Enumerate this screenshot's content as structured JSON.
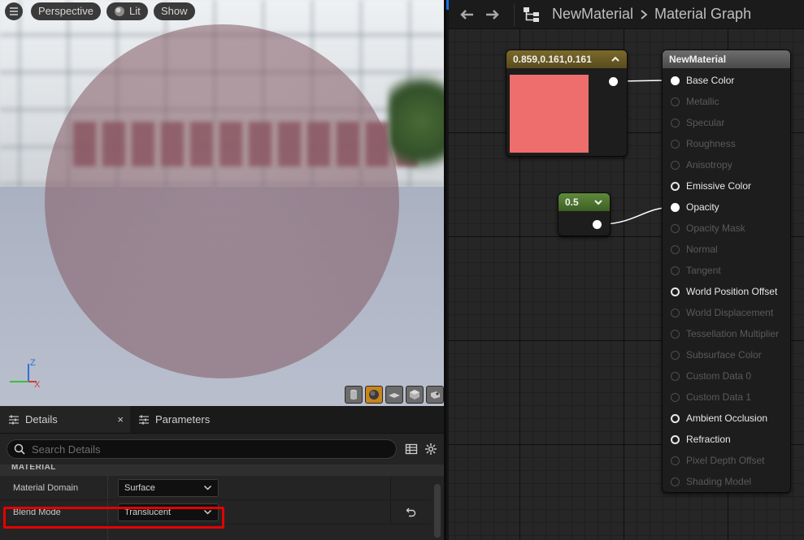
{
  "viewport": {
    "buttons": {
      "perspective": "Perspective",
      "lit": "Lit",
      "show": "Show"
    },
    "axis": {
      "z": "Z",
      "x": "X"
    }
  },
  "details": {
    "tabs": {
      "details": "Details",
      "close": "×",
      "parameters": "Parameters"
    },
    "search_placeholder": "Search Details",
    "section": "MATERIAL",
    "properties": [
      {
        "label": "Material Domain",
        "value": "Surface"
      },
      {
        "label": "Blend Mode",
        "value": "Translucent"
      }
    ]
  },
  "graph": {
    "breadcrumb": {
      "asset": "NewMaterial",
      "view": "Material Graph"
    },
    "color_node": {
      "title": "0.859,0.161,0.161",
      "swatch_color": "#ee6d6d"
    },
    "scalar_node": {
      "title": "0.5"
    },
    "main_node": {
      "title": "NewMaterial",
      "pins": [
        {
          "label": "Base Color",
          "state": "connected"
        },
        {
          "label": "Metallic",
          "state": "disabled"
        },
        {
          "label": "Specular",
          "state": "disabled"
        },
        {
          "label": "Roughness",
          "state": "disabled"
        },
        {
          "label": "Anisotropy",
          "state": "disabled"
        },
        {
          "label": "Emissive Color",
          "state": "enabled"
        },
        {
          "label": "Opacity",
          "state": "connected"
        },
        {
          "label": "Opacity Mask",
          "state": "disabled"
        },
        {
          "label": "Normal",
          "state": "disabled"
        },
        {
          "label": "Tangent",
          "state": "disabled"
        },
        {
          "label": "World Position Offset",
          "state": "enabled"
        },
        {
          "label": "World Displacement",
          "state": "disabled"
        },
        {
          "label": "Tessellation Multiplier",
          "state": "disabled"
        },
        {
          "label": "Subsurface Color",
          "state": "disabled"
        },
        {
          "label": "Custom Data 0",
          "state": "disabled"
        },
        {
          "label": "Custom Data 1",
          "state": "disabled"
        },
        {
          "label": "Ambient Occlusion",
          "state": "enabled"
        },
        {
          "label": "Refraction",
          "state": "enabled"
        },
        {
          "label": "Pixel Depth Offset",
          "state": "disabled"
        },
        {
          "label": "Shading Model",
          "state": "disabled"
        }
      ]
    }
  },
  "colors": {
    "highlight": "#e50000",
    "accent_blue": "#1a6fe0",
    "color_node_header": "#7a6a2a",
    "scalar_node_header": "#5f8a3c"
  }
}
